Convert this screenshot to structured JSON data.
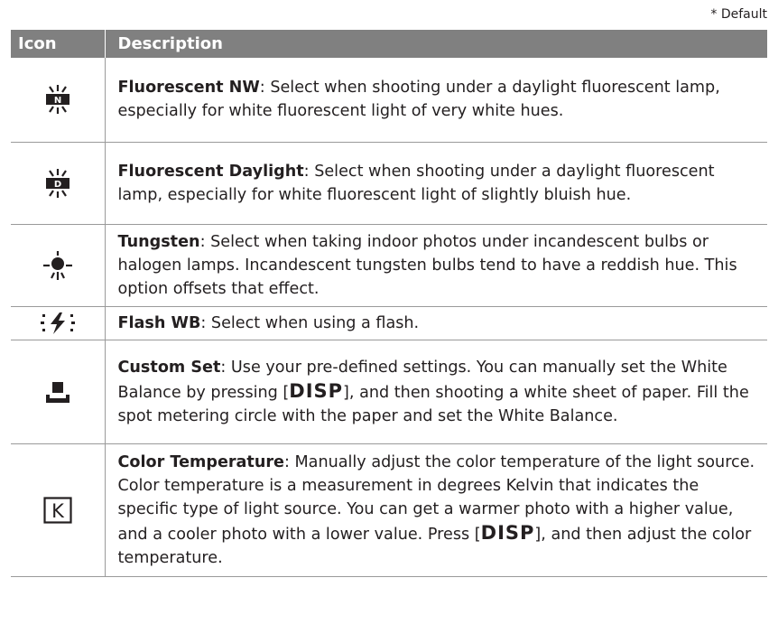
{
  "note": "* Default",
  "headers": {
    "icon": "Icon",
    "description": "Description"
  },
  "rows": [
    {
      "icon": "fluorescent-nw-icon",
      "icon_letter": "N",
      "title": "Fluorescent NW",
      "text": ": Select when shooting under a daylight fluorescent lamp, especially for white fluorescent light of very white hues."
    },
    {
      "icon": "fluorescent-daylight-icon",
      "icon_letter": "D",
      "title": "Fluorescent Daylight",
      "text": ": Select when shooting under a daylight fluorescent lamp, especially for white fluorescent light of slightly bluish hue."
    },
    {
      "icon": "tungsten-icon",
      "title": "Tungsten",
      "text": ": Select when taking indoor photos under incandescent bulbs or halogen lamps. Incandescent tungsten bulbs tend to have a reddish hue. This option offsets that effect."
    },
    {
      "icon": "flash-wb-icon",
      "title": "Flash WB",
      "text": ": Select when using a flash."
    },
    {
      "icon": "custom-set-icon",
      "title": "Custom Set",
      "text": ": Use your pre-defined settings. You can manually set the White Balance by pressing [",
      "key": "DISP",
      "text_after": "], and then shooting a white sheet of paper. Fill the spot metering circle with the paper and set the White Balance."
    },
    {
      "icon": "color-temperature-icon",
      "icon_letter": "K",
      "title": "Color Temperature",
      "text": ": Manually adjust the color temperature of the light source. Color temperature is a measurement in degrees Kelvin that indicates the specific type of light source. You can get a warmer photo with a higher value, and a cooler photo with a lower value. Press [",
      "key": "DISP",
      "text_after": "], and then adjust the color temperature."
    }
  ],
  "colors": {
    "header_bg": "#808080",
    "rule": "#9a9a9a",
    "text": "#231f20"
  }
}
